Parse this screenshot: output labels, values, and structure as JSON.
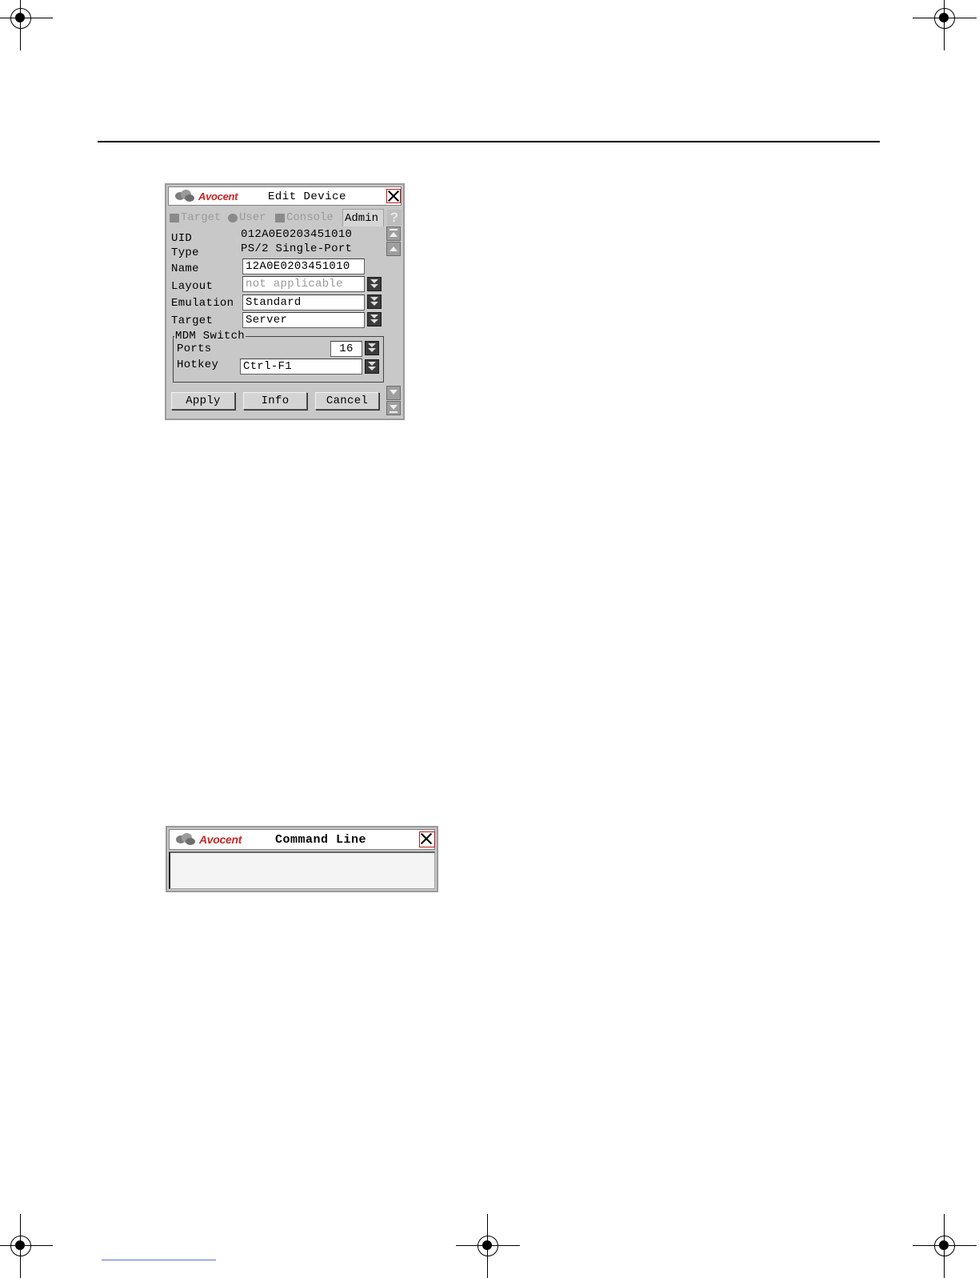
{
  "edit_device": {
    "brand": "Avocent",
    "title": "Edit Device",
    "tabs": [
      "Target",
      "User",
      "Console",
      "Admin"
    ],
    "active_tab": "Admin",
    "help_glyph": "?",
    "fields": {
      "uid_label": "UID",
      "uid_value": "012A0E0203451010",
      "type_label": "Type",
      "type_value": "PS/2 Single-Port",
      "name_label": "Name",
      "name_value": "12A0E0203451010",
      "layout_label": "Layout",
      "layout_value": "not applicable",
      "emulation_label": "Emulation",
      "emulation_value": "Standard",
      "target_label": "Target",
      "target_value": "Server"
    },
    "mdm_switch": {
      "legend": "MDM Switch",
      "ports_label": "Ports",
      "ports_value": "16",
      "hotkey_label": "Hotkey",
      "hotkey_value": "Ctrl-F1"
    },
    "buttons": {
      "apply": "Apply",
      "info": "Info",
      "cancel": "Cancel"
    }
  },
  "command_line": {
    "brand": "Avocent",
    "title": "Command Line",
    "input_value": ""
  },
  "colors": {
    "brand_red": "#c62828",
    "window_gray": "#c8c8c8"
  },
  "icons": [
    "registration-mark-icon",
    "avocent-logo-icon",
    "close-icon",
    "target-tab-icon",
    "user-tab-icon",
    "console-tab-icon",
    "help-icon",
    "dropdown-arrow-icon",
    "scroll-top-icon",
    "scroll-up-icon",
    "scroll-down-icon",
    "scroll-bottom-icon"
  ]
}
